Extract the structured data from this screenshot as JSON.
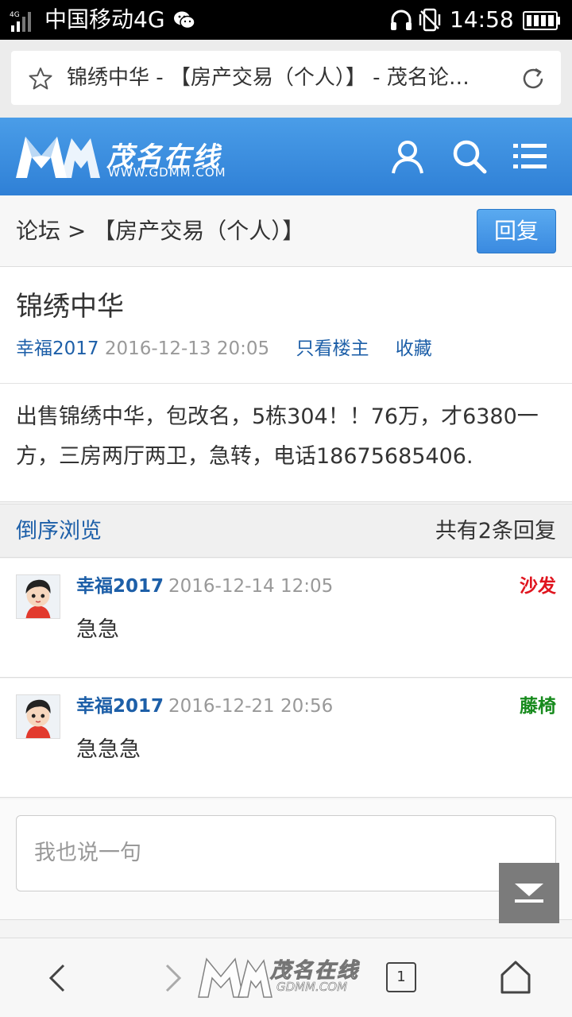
{
  "status_bar": {
    "carrier": "中国移动4G",
    "network_tag": "4G",
    "time": "14:58"
  },
  "browser": {
    "page_title": "锦绣中华 - 【房产交易（个人）】 - 茂名论…",
    "tab_count": "1"
  },
  "site": {
    "brand": "茂名在线",
    "url": "WWW.GDMM.COM",
    "header_color": "#3a8ae0"
  },
  "breadcrumb": {
    "text": "论坛 > 【房产交易（个人）】",
    "reply_button": "回复"
  },
  "post": {
    "title": "锦绣中华",
    "author": "幸福2017",
    "time": "2016-12-13 20:05",
    "only_op": "只看楼主",
    "favorite": "收藏",
    "body": "出售锦绣中华，包改名，5栋304！！76万，才6380一方，三房两厅两卫，急转，电话18675685406."
  },
  "reply_list": {
    "order": "倒序浏览",
    "count": "共有2条回复",
    "items": [
      {
        "author": "幸福2017",
        "time": "2016-12-14 12:05",
        "floor": "沙发",
        "floor_color": "#e0141e",
        "text": "急急"
      },
      {
        "author": "幸福2017",
        "time": "2016-12-21 20:56",
        "floor": "藤椅",
        "floor_color": "#168a1c",
        "text": "急急急"
      }
    ]
  },
  "comment": {
    "placeholder": "我也说一句"
  },
  "watermark": {
    "brand": "茂名在线",
    "url": "GDMM.COM"
  }
}
